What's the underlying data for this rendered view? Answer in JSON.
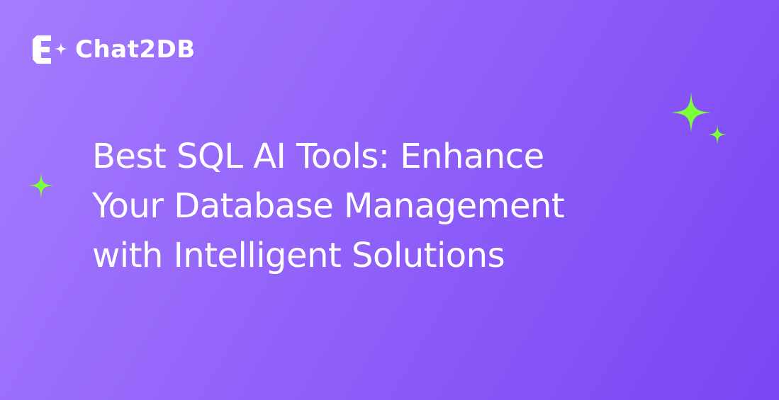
{
  "brand": {
    "name": "Chat2DB",
    "logo_icon": "chat2db-logo-icon"
  },
  "headline": {
    "lines": [
      "Best SQL AI Tools: Enhance",
      "Your Database Management",
      "with Intelligent Solutions"
    ]
  },
  "decorations": {
    "sparkle_icon": "sparkle-icon",
    "sparkle_color": "#7dff3a"
  },
  "colors": {
    "background_start": "#a57cff",
    "background_end": "#7a45f3",
    "text": "#ffffff"
  }
}
